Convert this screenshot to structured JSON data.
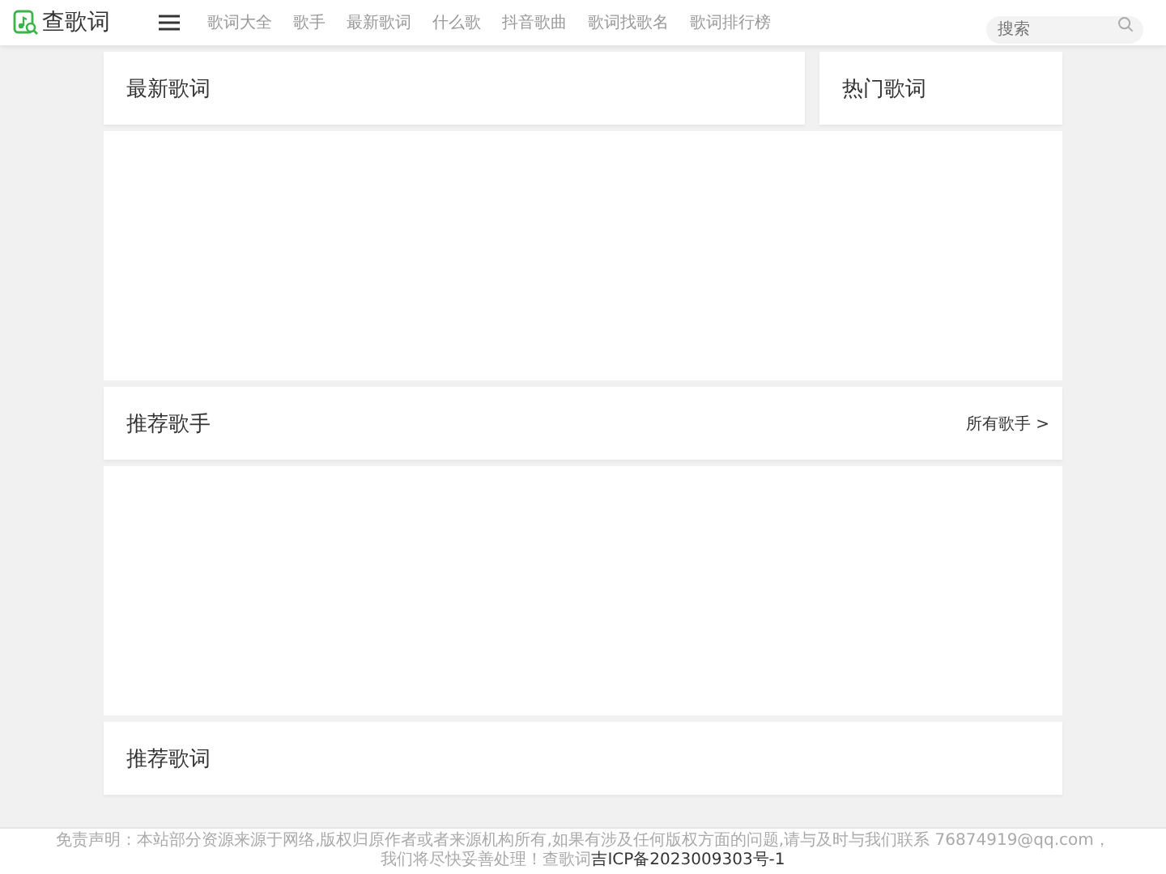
{
  "header": {
    "logo": "查歌词",
    "nav": [
      "歌词大全",
      "歌手",
      "最新歌词",
      "什么歌",
      "抖音歌曲",
      "歌词找歌名",
      "歌词排行榜"
    ],
    "search": {
      "placeholder": "搜索"
    }
  },
  "sections": [
    {
      "title": "最新歌词"
    },
    {
      "title": "热门歌词"
    }
  ],
  "singers": {
    "title": "推荐歌手",
    "link": "所有歌手 >"
  },
  "recommended": {
    "title": "推荐歌词"
  },
  "footer": {
    "text": "免责声明：本站部分资源来源于网络,版权归原作者或者来源机构所有,如果有涉及任何版权方面的问题,请与及时与我们联系 76874919@qq.com，我们将尽快妥善处理！查歌词",
    "icp": "吉ICP备2023009303号-1"
  }
}
